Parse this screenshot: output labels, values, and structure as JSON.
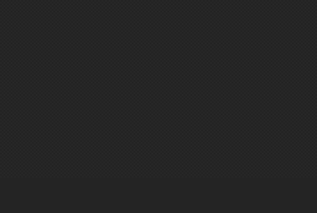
{
  "screen": {
    "background_color": "#232323",
    "content_visible": false
  }
}
